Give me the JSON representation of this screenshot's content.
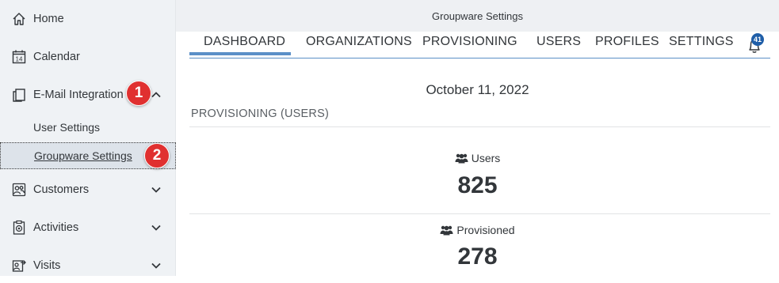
{
  "sidebar": {
    "items": [
      {
        "label": "Home",
        "icon": "home-icon"
      },
      {
        "label": "Calendar",
        "icon": "calendar-icon",
        "icon_text": "14"
      },
      {
        "label": "E-Mail Integration",
        "icon": "copy-icon",
        "expanded": true,
        "step_number": "1"
      },
      {
        "label": "Customers",
        "icon": "customers-icon"
      },
      {
        "label": "Activities",
        "icon": "activities-icon"
      },
      {
        "label": "Visits",
        "icon": "visits-icon"
      }
    ],
    "sub_items": [
      {
        "label": "User Settings"
      },
      {
        "label": "Groupware Settings",
        "selected": true,
        "step_number": "2"
      }
    ]
  },
  "header": {
    "title": "Groupware Settings"
  },
  "tabs": [
    {
      "label": "DASHBOARD",
      "active": true
    },
    {
      "label": "ORGANIZATIONS"
    },
    {
      "label": "PROVISIONING"
    },
    {
      "label": "USERS"
    },
    {
      "label": "PROFILES"
    },
    {
      "label": "SETTINGS"
    }
  ],
  "notifications": {
    "count": "41"
  },
  "dashboard": {
    "date": "October 11, 2022",
    "section_title": "PROVISIONING (USERS)",
    "metrics": [
      {
        "label": "Users",
        "value": "825"
      },
      {
        "label": "Provisioned",
        "value": "278"
      }
    ]
  },
  "colors": {
    "accent": "#5b8fc7",
    "badge_red": "#e03030",
    "badge_blue": "#1f5ea8",
    "sidebar_bg": "#eff2f5",
    "selected_bg": "#dde3ea"
  }
}
